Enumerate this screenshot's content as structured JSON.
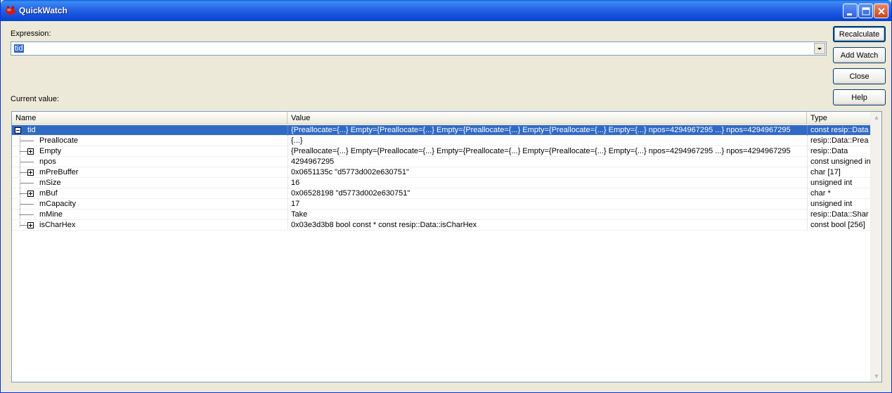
{
  "window": {
    "title": "QuickWatch"
  },
  "expression": {
    "label": "Expression:",
    "value": "tid"
  },
  "current_value_label": "Current value:",
  "buttons": {
    "recalculate": "Recalculate",
    "add_watch": "Add Watch",
    "close": "Close",
    "help": "Help"
  },
  "grid": {
    "columns": [
      "Name",
      "Value",
      "Type"
    ],
    "rows": [
      {
        "name": "tid",
        "value": "{Preallocate={...} Empty={Preallocate={...} Empty={Preallocate={...} Empty={Preallocate={...} Empty={...} npos=4294967295 ...} npos=4294967295",
        "type": "const resip::Data"
      },
      {
        "name": "Preallocate",
        "value": "{...}",
        "type": "resip::Data::Prea"
      },
      {
        "name": "Empty",
        "value": "{Preallocate={...} Empty={Preallocate={...} Empty={Preallocate={...} Empty={Preallocate={...} Empty={...} npos=4294967295 ...} npos=4294967295",
        "type": "resip::Data"
      },
      {
        "name": "npos",
        "value": "4294967295",
        "type": "const unsigned in"
      },
      {
        "name": "mPreBuffer",
        "value": "0x0651135c \"d5773d002e630751\"",
        "type": "char [17]"
      },
      {
        "name": "mSize",
        "value": "16",
        "type": "unsigned int"
      },
      {
        "name": "mBuf",
        "value": "0x06528198 \"d5773d002e630751\"",
        "type": "char *"
      },
      {
        "name": "mCapacity",
        "value": "17",
        "type": "unsigned int"
      },
      {
        "name": "mMine",
        "value": "Take",
        "type": "resip::Data::Shar"
      },
      {
        "name": "isCharHex",
        "value": "0x03e3d3b8 bool const * const resip::Data::isCharHex",
        "type": "const bool [256]"
      }
    ]
  }
}
